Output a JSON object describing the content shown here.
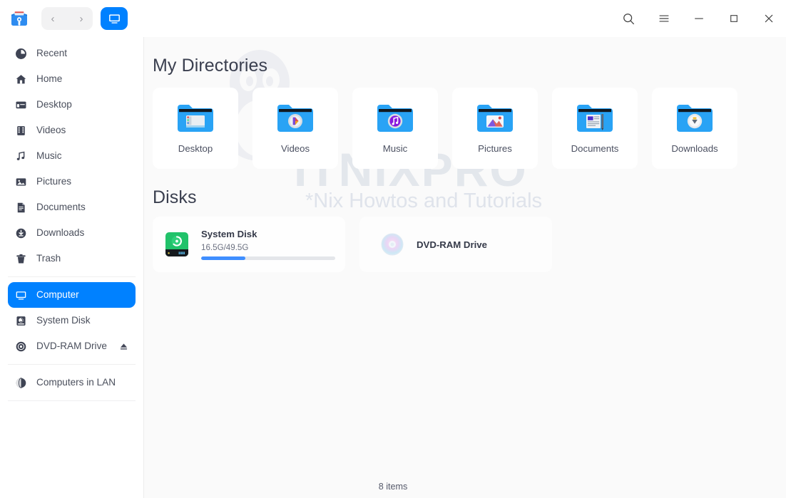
{
  "window": {
    "app_icon": "file-manager-icon",
    "nav": {
      "back": "‹",
      "forward": "›"
    },
    "current_tab_icon": "computer-icon",
    "actions": {
      "search": "search-icon",
      "menu": "hamburger-menu-icon",
      "minimize": "minimize-icon",
      "maximize": "maximize-icon",
      "close": "close-icon"
    }
  },
  "sidebar": {
    "items": [
      {
        "label": "Recent",
        "icon": "clock-icon",
        "active": false
      },
      {
        "label": "Home",
        "icon": "home-icon",
        "active": false
      },
      {
        "label": "Desktop",
        "icon": "desktop-icon",
        "active": false
      },
      {
        "label": "Videos",
        "icon": "film-icon",
        "active": false
      },
      {
        "label": "Music",
        "icon": "music-note-icon",
        "active": false
      },
      {
        "label": "Pictures",
        "icon": "image-icon",
        "active": false
      },
      {
        "label": "Documents",
        "icon": "document-icon",
        "active": false
      },
      {
        "label": "Downloads",
        "icon": "download-icon",
        "active": false
      },
      {
        "label": "Trash",
        "icon": "trash-icon",
        "active": false
      },
      {
        "label": "Computer",
        "icon": "computer-icon",
        "active": true
      },
      {
        "label": "System Disk",
        "icon": "harddisk-icon",
        "active": false
      },
      {
        "label": "DVD-RAM Drive",
        "icon": "disc-icon",
        "active": false,
        "eject": "eject-icon"
      },
      {
        "label": "Computers in LAN",
        "icon": "network-icon",
        "active": false
      }
    ]
  },
  "main": {
    "directories_title": "My Directories",
    "directories": [
      {
        "name": "Desktop",
        "icon": "folder-desktop-icon"
      },
      {
        "name": "Videos",
        "icon": "folder-videos-icon"
      },
      {
        "name": "Music",
        "icon": "folder-music-icon"
      },
      {
        "name": "Pictures",
        "icon": "folder-pictures-icon"
      },
      {
        "name": "Documents",
        "icon": "folder-documents-icon"
      },
      {
        "name": "Downloads",
        "icon": "folder-downloads-icon"
      }
    ],
    "disks_title": "Disks",
    "disks": [
      {
        "name": "System Disk",
        "capacity": "16.5G/49.5G",
        "used_percent": 33,
        "icon": "system-disk-icon"
      },
      {
        "name": "DVD-RAM Drive",
        "capacity": "",
        "used_percent": 0,
        "icon": "dvd-disc-icon"
      }
    ]
  },
  "watermark": {
    "title": "ITNIXPRO",
    "subtitle": "*Nix Howtos and Tutorials"
  },
  "statusbar": {
    "items_count": "8 items"
  },
  "colors": {
    "accent": "#0081ff",
    "progress": "#3f8eff",
    "disk_green": "#21c26a",
    "sidebar_text": "#4a4f5c",
    "main_bg": "#fafafa"
  }
}
